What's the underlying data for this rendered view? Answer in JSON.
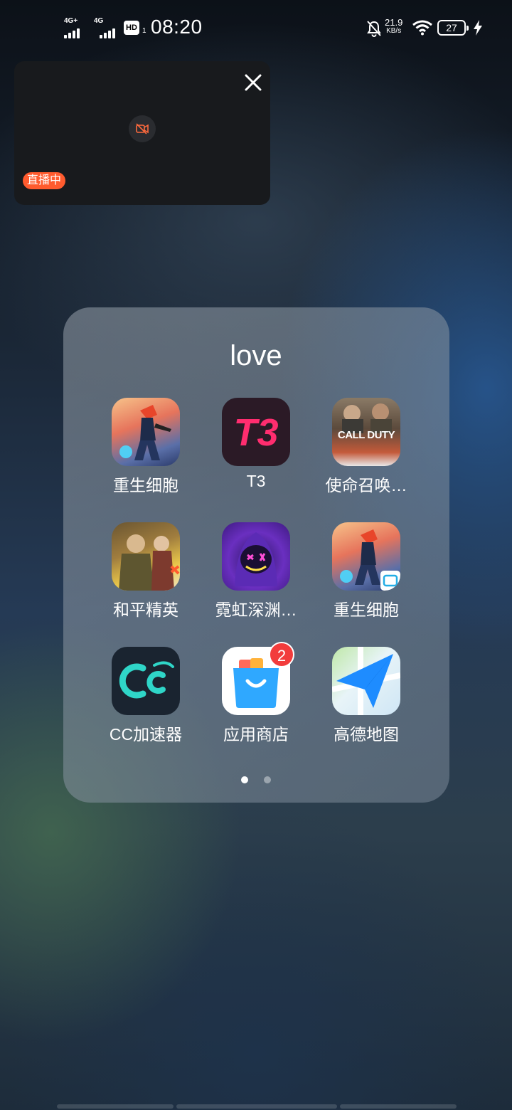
{
  "status_bar": {
    "sim1_tech": "4G+",
    "sim2_tech": "4G",
    "hd_label": "HD",
    "hd_sub": "1",
    "time": "08:20",
    "net_speed": "21.9",
    "net_unit": "KB/s",
    "battery": "27"
  },
  "float_window": {
    "live_badge": "直播中"
  },
  "folder": {
    "title": "love",
    "apps": [
      {
        "label": "重生细胞"
      },
      {
        "label": "T3",
        "icon_text": "T3"
      },
      {
        "label": "使命召唤…",
        "icon_text": "CALL DUTY"
      },
      {
        "label": "和平精英"
      },
      {
        "label": "霓虹深渊…"
      },
      {
        "label": "重生细胞"
      },
      {
        "label": "CC加速器"
      },
      {
        "label": "应用商店",
        "badge": "2"
      },
      {
        "label": "高德地图"
      }
    ],
    "page_count": 2,
    "current_page": 1
  }
}
